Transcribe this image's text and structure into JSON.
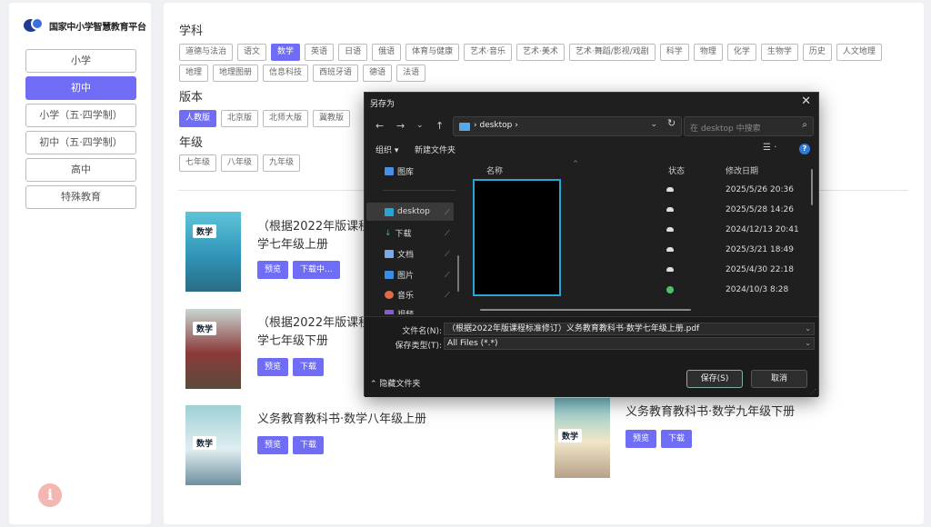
{
  "sidebar": {
    "logo_text": "国家中小学智慧教育平台",
    "items": [
      {
        "label": "小学",
        "active": false
      },
      {
        "label": "初中",
        "active": true
      },
      {
        "label": "小学（五·四学制）",
        "active": false
      },
      {
        "label": "初中（五·四学制）",
        "active": false
      },
      {
        "label": "高中",
        "active": false
      },
      {
        "label": "特殊教育",
        "active": false
      }
    ],
    "info_icon": "i"
  },
  "filters": {
    "subject_title": "学科",
    "subjects": [
      "道德与法治",
      "语文",
      "数学",
      "英语",
      "日语",
      "俄语",
      "体育与健康",
      "艺术·音乐",
      "艺术·美术",
      "艺术·舞蹈/影视/戏剧",
      "科学",
      "物理",
      "化学",
      "生物学",
      "历史",
      "人文地理",
      "地理",
      "地理图册",
      "信息科技",
      "西班牙语",
      "德语",
      "法语"
    ],
    "subject_active": "数学",
    "edition_title": "版本",
    "editions": [
      "人教版",
      "北京版",
      "北师大版",
      "冀教版"
    ],
    "edition_active": "人教版",
    "grade_title": "年级",
    "grades": [
      "七年级",
      "八年级",
      "九年级"
    ]
  },
  "books": [
    {
      "title_line1": "（根据2022年版课程",
      "title_line2": "学七年级上册",
      "cover_label": "数学",
      "btn1": "预览",
      "btn2": "下载中..."
    },
    {
      "title_line1": "（根据2022年版课程",
      "title_line2": "学七年级下册",
      "cover_label": "数学",
      "btn1": "预览",
      "btn2": "下载"
    },
    {
      "title_line1": "义务教育教科书·数学八年级上册",
      "cover_label": "数学",
      "btn1": "预览",
      "btn2": "下载"
    },
    {
      "title_line1": "义务教育教科书·数学九年级下册",
      "cover_label": "数学",
      "btn1": "预览",
      "btn2": "下载"
    }
  ],
  "dialog": {
    "title": "另存为",
    "close": "✕",
    "path": "desktop",
    "path_sep": "›",
    "refresh": "↻",
    "search_placeholder": "在 desktop 中搜索",
    "organize": "组织 ▾",
    "new_folder": "新建文件夹",
    "nav_items": [
      {
        "label": "图库",
        "color": "#4a90e2"
      },
      {
        "label": "desktop",
        "color": "#2aa3d6"
      },
      {
        "label": "下载",
        "color": "#3bb36a"
      },
      {
        "label": "文档",
        "color": "#7aa9e8"
      },
      {
        "label": "图片",
        "color": "#3a8de0"
      },
      {
        "label": "音乐",
        "color": "#e06a4a"
      },
      {
        "label": "视频",
        "color": "#8a5ad6"
      }
    ],
    "columns": {
      "name": "名称",
      "status": "状态",
      "date": "修改日期"
    },
    "files": [
      {
        "date": "2025/5/26 20:36",
        "status": "cloud"
      },
      {
        "date": "2025/5/28 14:26",
        "status": "cloud"
      },
      {
        "date": "2024/12/13 20:41",
        "status": "cloud"
      },
      {
        "date": "2025/3/21 18:49",
        "status": "cloud"
      },
      {
        "date": "2025/4/30 22:18",
        "status": "cloud"
      },
      {
        "date": "2024/10/3 8:28",
        "status": "ok"
      }
    ],
    "filename_label": "文件名(N):",
    "filename_value": "（根据2022年版课程标准修订）义务教育教科书·数学七年级上册.pdf",
    "filetype_label": "保存类型(T):",
    "filetype_value": "All Files (*.*)",
    "hide_folders": "隐藏文件夹",
    "save_label": "保存(S)",
    "cancel_label": "取消"
  }
}
